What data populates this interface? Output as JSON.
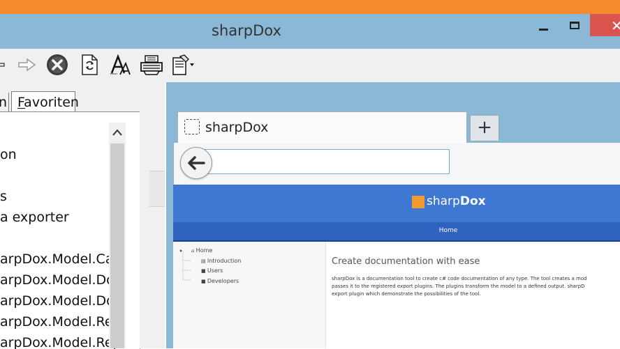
{
  "window": {
    "title": "sharpDox",
    "close_glyph": "✕"
  },
  "toolbar": {
    "icons": [
      "back-arrow-icon",
      "forward-arrow-icon",
      "stop-icon",
      "refresh-page-icon",
      "font-icon",
      "print-icon",
      "options-icon"
    ]
  },
  "left_panel": {
    "tabs": [
      {
        "label": "n"
      },
      {
        "label": "Favoriten"
      }
    ],
    "tree_items": [
      {
        "label": "on"
      },
      {
        "label": "s"
      },
      {
        "label": "a exporter"
      },
      {
        "label": "arpDox.Model.Call"
      },
      {
        "label": "arpDox.Model.Doc"
      },
      {
        "label": "arpDox.Model.Doc"
      },
      {
        "label": "arpDox.Model.Rep"
      },
      {
        "label": "arpDox.Model.Rep"
      }
    ],
    "scroll_up_glyph": "^"
  },
  "browser": {
    "tab_title": "sharpDox",
    "new_tab_glyph": "+",
    "back_glyph": "←",
    "url_value": "",
    "site": {
      "logo_light": "sharp",
      "logo_bold": "Dox",
      "nav_home": "Home",
      "tree": [
        {
          "label": "Home"
        },
        {
          "label": "Introduction"
        },
        {
          "label": "Users"
        },
        {
          "label": "Developers"
        }
      ],
      "heading": "Create documentation with ease",
      "paragraph_lines": [
        "sharpDox is a documentation tool to create c# code documentation of any type. The tool creates a mod",
        "passes it to the registered export plugins. The plugins transform the model to a defined output. sharpD",
        "export plugin which demonstrate the possibilities of the tool."
      ]
    }
  },
  "colors": {
    "accent_orange": "#f58a2e",
    "titlebar_blue": "#8ab8d6",
    "close_red": "#d9534f",
    "site_header_blue": "#3f78d2"
  }
}
